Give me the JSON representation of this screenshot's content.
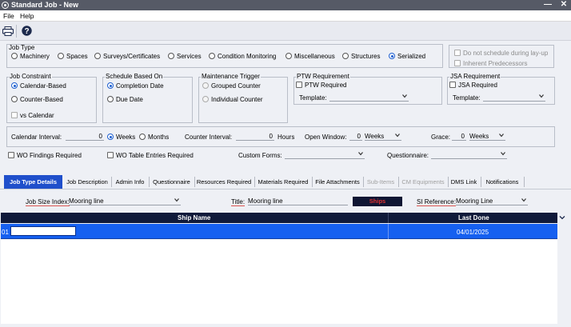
{
  "window": {
    "title": "Standard Job - New",
    "minimize": "—",
    "close": "✕"
  },
  "menu": [
    "File",
    "Help"
  ],
  "job_type": {
    "label": "Job Type",
    "options": [
      "Machinery",
      "Spaces",
      "Surveys/Certificates",
      "Services",
      "Condition Monitoring",
      "Miscellaneous",
      "Structures",
      "Serialized"
    ],
    "selected": "Serialized"
  },
  "layup": {
    "do_not_schedule": "Do not schedule during lay-up",
    "inherent_predecessors": "Inherent Predecessors"
  },
  "job_constraint": {
    "label": "Job Constraint",
    "options": [
      "Calendar-Based",
      "Counter-Based"
    ],
    "vs_calendar": "vs Calendar",
    "selected": "Calendar-Based"
  },
  "schedule_based_on": {
    "label": "Schedule Based On",
    "options": [
      "Completion Date",
      "Due Date"
    ],
    "selected": "Completion Date"
  },
  "maintenance_trigger": {
    "label": "Maintenance Trigger",
    "options": [
      "Grouped Counter",
      "Individual Counter"
    ]
  },
  "ptw": {
    "label": "PTW Requirement",
    "required": "PTW Required",
    "template_label": "Template:"
  },
  "jsa": {
    "label": "JSA Requirement",
    "required": "JSA Required",
    "template_label": "Template:"
  },
  "intervals": {
    "calendar_interval_label": "Calendar Interval:",
    "calendar_interval_value": "0",
    "weeks": "Weeks",
    "months": "Months",
    "counter_interval_label": "Counter Interval:",
    "counter_interval_value": "0",
    "hours": "Hours",
    "open_window_label": "Open Window:",
    "open_window_value": "0",
    "open_window_unit": "Weeks",
    "grace_label": "Grace:",
    "grace_value": "0",
    "grace_unit": "Weeks"
  },
  "options_row": {
    "wo_findings": "WO Findings Required",
    "wo_table_entries": "WO Table Entries Required",
    "custom_forms": "Custom Forms:",
    "questionnaire": "Questionnaire:"
  },
  "tabs": [
    {
      "label": "Job Type Details"
    },
    {
      "label": "Job Description"
    },
    {
      "label": "Admin Info"
    },
    {
      "label": "Questionnaire"
    },
    {
      "label": "Resources Required"
    },
    {
      "label": "Materials Required"
    },
    {
      "label": "File Attachments"
    },
    {
      "label": "Sub-Items"
    },
    {
      "label": "CM Equipments"
    },
    {
      "label": "DMS Link"
    },
    {
      "label": "Notifications"
    }
  ],
  "details": {
    "job_size_index_label": "Job Size Index:",
    "job_size_index_value": "Mooring line",
    "title_label": "Title:",
    "title_value": "Mooring line",
    "ships_badge": "Ships",
    "si_reference_label": "SI Reference:",
    "si_reference_value": "Mooring Line"
  },
  "grid": {
    "columns": [
      "Ship Name",
      "Last Done"
    ],
    "rows": [
      {
        "code": "01",
        "ship_name": "",
        "last_done": "04/01/2025"
      }
    ]
  },
  "colors": {
    "accent": "#1f4fcb",
    "selected_row": "#1660f0",
    "grid_header": "#101a3a",
    "ships_text": "#e23232"
  }
}
